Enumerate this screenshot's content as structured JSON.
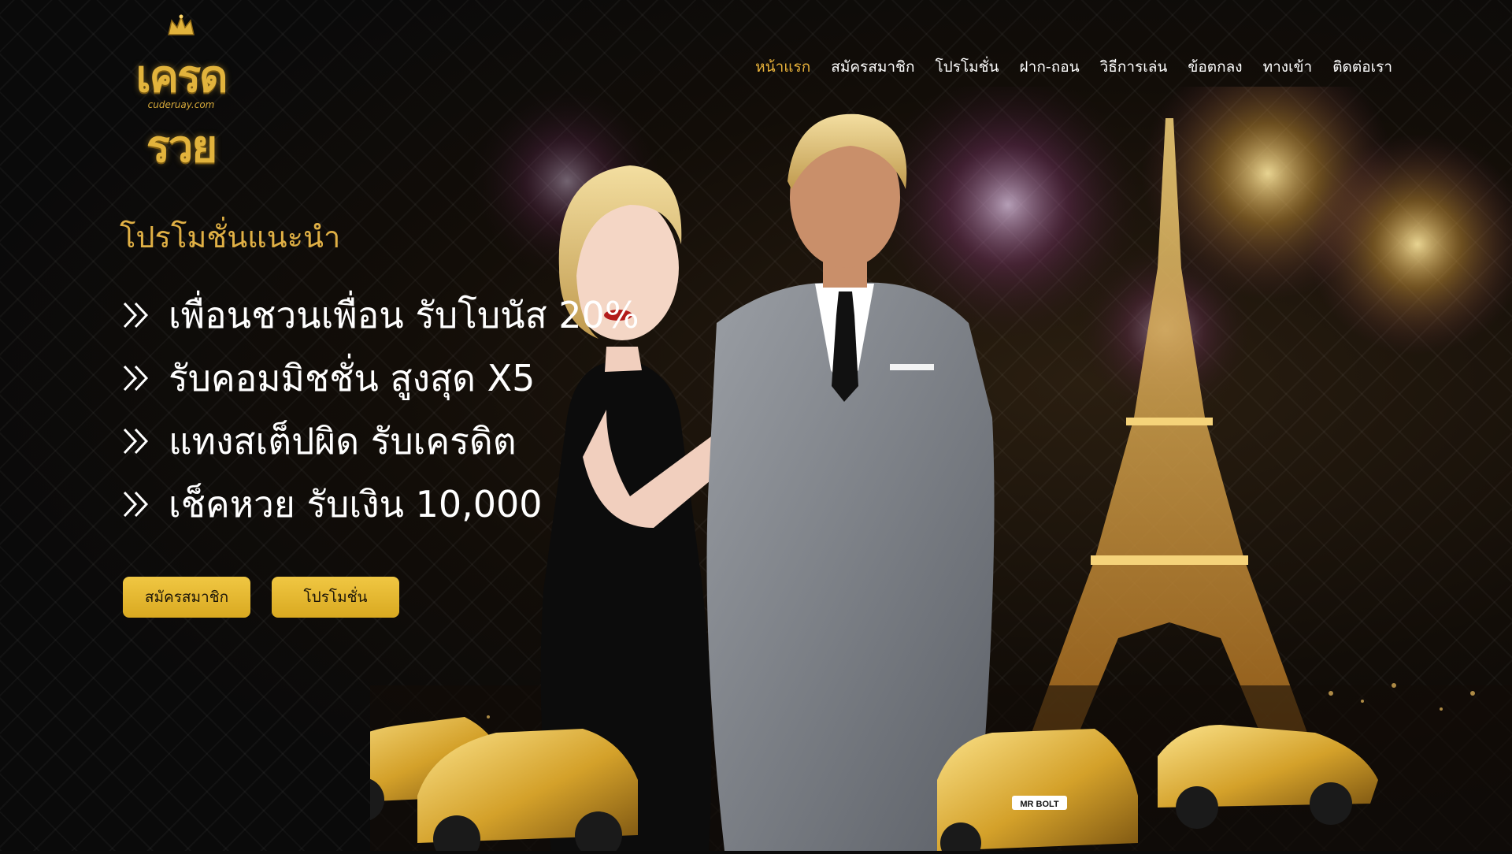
{
  "site": {
    "logo_text": "เครดรวย",
    "logo_sub": "cuderuay.com"
  },
  "nav": {
    "items": [
      {
        "label": "หน้าแรก",
        "active": true
      },
      {
        "label": "สมัครสมาชิก",
        "active": false
      },
      {
        "label": "โปรโมชั่น",
        "active": false
      },
      {
        "label": "ฝาก-ถอน",
        "active": false
      },
      {
        "label": "วิธีการเล่น",
        "active": false
      },
      {
        "label": "ข้อตกลง",
        "active": false
      },
      {
        "label": "ทางเข้า",
        "active": false
      },
      {
        "label": "ติดต่อเรา",
        "active": false
      }
    ]
  },
  "hero": {
    "heading": "โปรโมชั่นแนะนำ",
    "items": [
      "เพื่อนชวนเพื่อน รับโบนัส 20%",
      "รับคอมมิชชั่น สูงสุด X5",
      "แทงสเต็ปผิด รับเครดิต",
      "เช็คหวย รับเงิน 10,000"
    ],
    "buttons": {
      "signup": "สมัครสมาชิก",
      "promotion": "โปรโมชั่น"
    },
    "car_plate": "MR BOLT"
  },
  "colors": {
    "accent": "#e8b23a",
    "button": "#e0b42f",
    "text": "#ffffff",
    "background": "#0b0b0b"
  }
}
